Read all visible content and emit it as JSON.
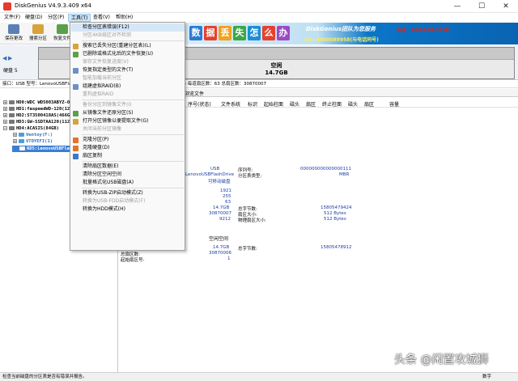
{
  "window": {
    "title": "DiskGenius V4.9.3.409 x64",
    "minimize": "—",
    "maximize": "☐",
    "close": "✕"
  },
  "menubar": [
    {
      "label": "文件(F)"
    },
    {
      "label": "硬盘(D)"
    },
    {
      "label": "分区(P)"
    },
    {
      "label": "工具(T)"
    },
    {
      "label": "查看(V)"
    },
    {
      "label": "帮助(H)"
    }
  ],
  "toolbar": [
    {
      "label": "保存更改",
      "icon": "save-icon",
      "color": "#5b7fb5"
    },
    {
      "label": "搜索分区",
      "icon": "search-icon",
      "color": "#d9a23b"
    },
    {
      "label": "恢复文件",
      "icon": "recover-icon",
      "color": "#5aa04a"
    }
  ],
  "banner": {
    "chars": [
      "数",
      "据",
      "丢",
      "失",
      "怎",
      "么",
      "办"
    ],
    "char_colors": [
      "#2b7bd3",
      "#e5412e",
      "#f2a21c",
      "#39a845",
      "#1c8ed6",
      "#e5412e",
      "#9b4bc4"
    ],
    "slogan": "DiskGenius团队为您服务",
    "phone": "电话：400-008-9958",
    "qq": "QQ: 4000089958(与电话同号)"
  },
  "diskbar": {
    "disk_label": "硬盘 5",
    "partition_name": "空闲",
    "partition_size": "14.7GB"
  },
  "infoline": "接口：USB  型号：LenovoUSBFlashDrive  ...7GB(15073MB)  柱面数：1921  磁头数：255  每道扇区数：63  总扇区数：30870007",
  "tree": [
    {
      "label": "HD0:WDC WD5003ABYZ-011FA0(466GB)",
      "level": 0,
      "selected": false
    },
    {
      "label": "HD1:faspeedWD-120(120GB)",
      "level": 0,
      "selected": false
    },
    {
      "label": "HD2:ST3500418AS(466GB)",
      "level": 0,
      "selected": false
    },
    {
      "label": "HD3:GW-SSDTAA120(112GB)",
      "level": 0,
      "selected": false
    },
    {
      "label": "HD4:ACASIS(84GB)",
      "level": 0,
      "selected": false
    },
    {
      "label": "Ventoy(F:)",
      "level": 1,
      "selected": false
    },
    {
      "label": "VTOYEFI(1)",
      "level": 1,
      "selected": false
    },
    {
      "label": "RD5:LenovoUSBFlashDrive(15GB)",
      "level": 0,
      "selected": true
    }
  ],
  "right_tab": "浏览文件",
  "columns": [
    "序号(状态)",
    "文件系统",
    "标识",
    "起始柱面",
    "磁头",
    "扇区",
    "终止柱面",
    "磁头",
    "扇区",
    "容量"
  ],
  "props": {
    "interface": "USB",
    "model": "LenovoUSBFlashDrive",
    "type": "可移动磁盘",
    "serial_label": "序列号:",
    "serial": "000000000000000111",
    "ptable_label": "分区表类型:",
    "ptable": "MBR",
    "cyl": "1921",
    "heads": "255",
    "spt": "63",
    "capacity": "14.7GB",
    "total_sectors_label": "总字节数:",
    "total_sectors": "15805479424",
    "sector_size_label": "扇区大小:",
    "sector_size": "512 Bytes",
    "phys_sector_label": "物理扇区大小:",
    "phys_sector": "512 Bytes",
    "sectors": "30870007",
    "extra": "9212",
    "free_title": "空闲空间",
    "free_capacity": "14.7GB",
    "free_total_label": "总字节数:",
    "free_total": "15805478912",
    "free_sectors_label": "总扇区数:",
    "free_sectors": "30870006",
    "start_sector_label": "起始扇区号:",
    "start_sector": "1"
  },
  "dropdown": [
    {
      "label": "检查分区表错误(F12)",
      "enabled": true,
      "hover": true,
      "icon": "none",
      "color": "#ffffff"
    },
    {
      "label": "分区4KB扇区对齐检测",
      "enabled": false,
      "hover": false,
      "icon": "none",
      "color": "#ffffff"
    },
    {
      "sep": true
    },
    {
      "label": "搜索已丢失分区(重建分区表)(L)",
      "enabled": true,
      "hover": false,
      "icon": "search-icon",
      "color": "#d9a23b"
    },
    {
      "label": "已删除或格式化后的文件恢复(U)",
      "enabled": true,
      "hover": false,
      "icon": "recover-icon",
      "color": "#5aa04a"
    },
    {
      "label": "保存文件恢复进度(V)",
      "enabled": false,
      "hover": false,
      "icon": "none",
      "color": "#ffffff"
    },
    {
      "label": "恢复指定类型的文件(T)",
      "enabled": true,
      "hover": false,
      "icon": "file-icon",
      "color": "#6c8fc6"
    },
    {
      "label": "智能加载当前分区",
      "enabled": false,
      "hover": false,
      "icon": "none",
      "color": "#ffffff"
    },
    {
      "label": "组建虚拟RAID(B)",
      "enabled": true,
      "hover": false,
      "icon": "raid-icon",
      "color": "#6c8fc6"
    },
    {
      "label": "重构虚拟RAID",
      "enabled": false,
      "hover": false,
      "icon": "none",
      "color": "#ffffff"
    },
    {
      "sep": true
    },
    {
      "label": "备份分区到镜像文件(I)",
      "enabled": false,
      "hover": false,
      "icon": "none",
      "color": "#ffffff"
    },
    {
      "label": "从镜像文件还原分区(S)",
      "enabled": true,
      "hover": false,
      "icon": "restore-icon",
      "color": "#5aa04a"
    },
    {
      "label": "打开分区镜像以便提取文件(G)",
      "enabled": true,
      "hover": false,
      "icon": "open-icon",
      "color": "#d9a23b"
    },
    {
      "label": "关闭当前分区镜像",
      "enabled": false,
      "hover": false,
      "icon": "none",
      "color": "#ffffff"
    },
    {
      "sep": true
    },
    {
      "label": "克隆分区(P)",
      "enabled": true,
      "hover": false,
      "icon": "clone-icon",
      "color": "#e2732b"
    },
    {
      "label": "克隆硬盘(D)",
      "enabled": true,
      "hover": false,
      "icon": "clone-disk-icon",
      "color": "#e2732b"
    },
    {
      "label": "扇区复制",
      "enabled": true,
      "hover": false,
      "icon": "copy-icon",
      "color": "#3c78c8"
    },
    {
      "sep": true
    },
    {
      "label": "清除扇区数据(E)",
      "enabled": true,
      "hover": false,
      "icon": "none",
      "color": "#ffffff"
    },
    {
      "label": "清除分区空闲空间",
      "enabled": true,
      "hover": false,
      "icon": "none",
      "color": "#ffffff"
    },
    {
      "label": "批量格式化USB磁盘(A)",
      "enabled": true,
      "hover": false,
      "icon": "none",
      "color": "#ffffff"
    },
    {
      "sep": true
    },
    {
      "label": "转换为USB-ZIP启动模式(Z)",
      "enabled": true,
      "hover": false,
      "icon": "none",
      "color": "#ffffff"
    },
    {
      "label": "转换为USB-FDD启动模式(F)",
      "enabled": false,
      "hover": false,
      "icon": "none",
      "color": "#ffffff"
    },
    {
      "label": "转换为HDD模式(H)",
      "enabled": true,
      "hover": false,
      "icon": "none",
      "color": "#ffffff"
    }
  ],
  "statusbar": {
    "text": "检查当前磁盘的分区表是否有错误并报告。",
    "num": "数字"
  },
  "watermark": "头条 @闲置攻城狮"
}
